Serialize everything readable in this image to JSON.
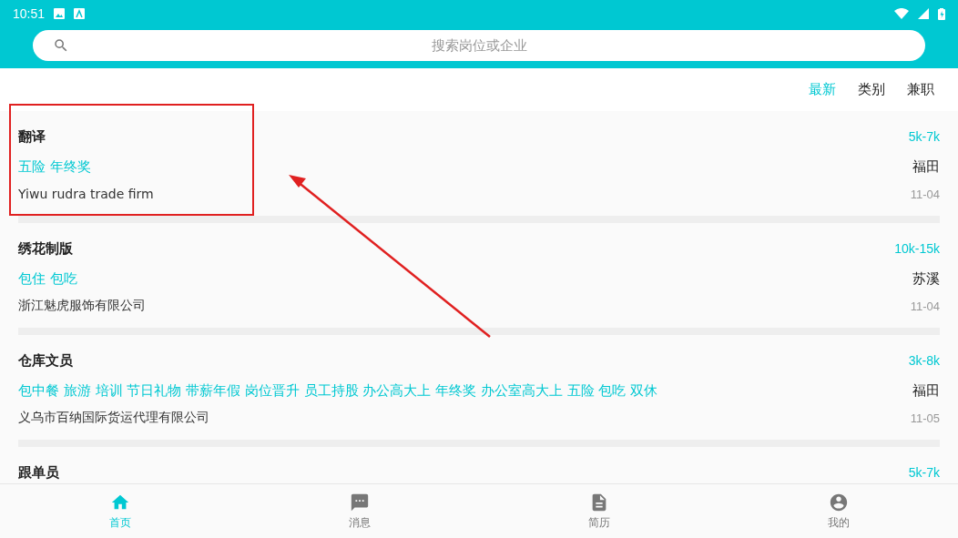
{
  "status_bar": {
    "time": "10:51"
  },
  "search": {
    "placeholder": "搜索岗位或企业"
  },
  "filter_tabs": [
    {
      "label": "最新",
      "selected": true
    },
    {
      "label": "类别",
      "selected": false
    },
    {
      "label": "兼职",
      "selected": false
    }
  ],
  "jobs": [
    {
      "title": "翻译",
      "salary": "5k-7k",
      "tags": "五险 年终奖",
      "location": "福田",
      "company": "Yiwu rudra trade firm",
      "date": "11-04"
    },
    {
      "title": "绣花制版",
      "salary": "10k-15k",
      "tags": "包住 包吃",
      "location": "苏溪",
      "company": "浙江魅虎服饰有限公司",
      "date": "11-04"
    },
    {
      "title": "仓库文员",
      "salary": "3k-8k",
      "tags": "包中餐 旅游 培训 节日礼物 带薪年假 岗位晋升 员工持股 办公高大上 年终奖 办公室高大上 五险 包吃 双休",
      "location": "福田",
      "company": "义乌市百纳国际货运代理有限公司",
      "date": "11-05"
    },
    {
      "title": "跟单员",
      "salary": "5k-7k"
    }
  ],
  "bottom_nav": [
    {
      "label": "首页",
      "kind": "home",
      "selected": true
    },
    {
      "label": "消息",
      "kind": "message",
      "selected": false
    },
    {
      "label": "简历",
      "kind": "document",
      "selected": false
    },
    {
      "label": "我的",
      "kind": "account",
      "selected": false
    }
  ]
}
